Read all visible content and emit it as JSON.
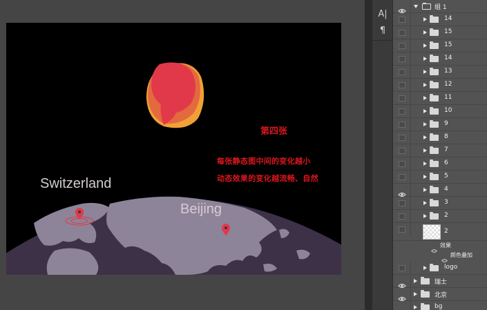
{
  "canvas": {
    "title": "第四张",
    "description_lines": [
      "每张静态图中间的变化越小",
      "动态效果的变化越流畅、自然"
    ],
    "labels": {
      "switzerland": "Switzerland",
      "beijing": "Beijing"
    },
    "colors": {
      "background": "#000000",
      "earth": "#3d3148",
      "continents": "#8d8499",
      "shape_outer": "#f0a035",
      "shape_mid": "#e26a3e",
      "shape_inner": "#e2394a",
      "pin": "#e2394a",
      "text_red": "#d9171c"
    }
  },
  "tools": [
    {
      "name": "character-icon",
      "glyph": "A|"
    },
    {
      "name": "paragraph-icon",
      "glyph": "¶"
    }
  ],
  "layers": {
    "group": {
      "name": "组 1",
      "visible": true,
      "expanded": true
    },
    "children": [
      {
        "name": "14",
        "visible": false
      },
      {
        "name": "15",
        "visible": false
      },
      {
        "name": "15",
        "visible": false
      },
      {
        "name": "14",
        "visible": false
      },
      {
        "name": "13",
        "visible": false
      },
      {
        "name": "12",
        "visible": false
      },
      {
        "name": "11",
        "visible": false
      },
      {
        "name": "10",
        "visible": false
      },
      {
        "name": "9",
        "visible": false
      },
      {
        "name": "8",
        "visible": false
      },
      {
        "name": "7",
        "visible": false
      },
      {
        "name": "6",
        "visible": false
      },
      {
        "name": "5",
        "visible": false
      },
      {
        "name": "4",
        "visible": true
      },
      {
        "name": "3",
        "visible": false
      },
      {
        "name": "2",
        "visible": false
      }
    ],
    "shape_layer": {
      "name": "2",
      "visible": false
    },
    "effects": {
      "label": "效果",
      "items": [
        "颜色叠加"
      ]
    },
    "logo": {
      "name": "logo",
      "visible": false
    },
    "top_level": [
      {
        "name": "瑞士",
        "visible": true
      },
      {
        "name": "北京",
        "visible": true
      },
      {
        "name": "bg",
        "visible": true
      }
    ]
  }
}
